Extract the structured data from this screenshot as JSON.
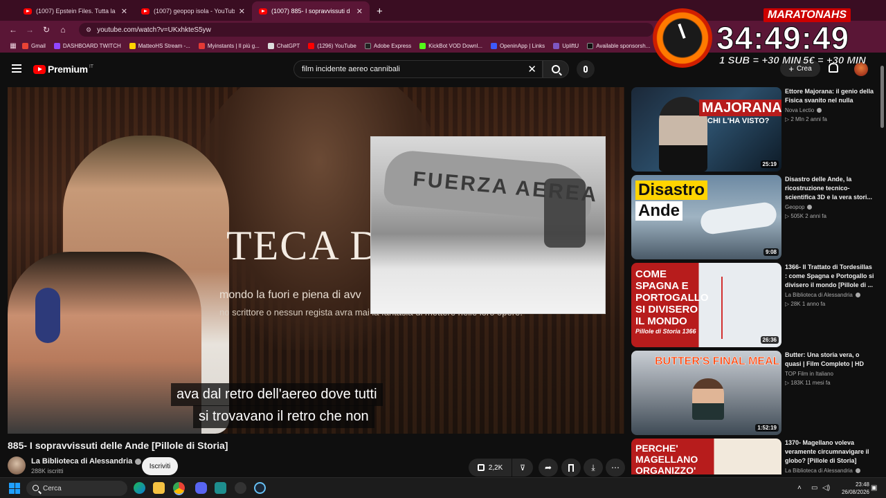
{
  "browser": {
    "tabs": [
      {
        "title": "(1007) Epstein Files. Tutta la sto",
        "active": false
      },
      {
        "title": "(1007) geopop isola - YouTube",
        "active": false
      },
      {
        "title": "(1007) 885- I sopravvissuti d",
        "active": true
      }
    ],
    "new_tab": "+",
    "close": "✕",
    "url": "youtube.com/watch?v=UKxhkteS5yw",
    "bookmarks": [
      {
        "label": "Gmail",
        "color": "#ea4335"
      },
      {
        "label": "DASHBOARD TWITCH",
        "color": "#9146ff"
      },
      {
        "label": "MatteoHS Stream -...",
        "color": "#ffd400"
      },
      {
        "label": "Myinstants | Il più g...",
        "color": "#e53935"
      },
      {
        "label": "ChatGPT",
        "color": "#dddddd"
      },
      {
        "label": "(1296) YouTube",
        "color": "#ff0000"
      },
      {
        "label": "Adobe Express",
        "color": "#222222"
      },
      {
        "label": "KickBot VOD Downl...",
        "color": "#53fc18"
      },
      {
        "label": "OpeninApp | Links",
        "color": "#3d5afe"
      },
      {
        "label": "UpliftU",
        "color": "#7e57c2"
      },
      {
        "label": "Available sponsorsh...",
        "color": "#111111"
      }
    ]
  },
  "youtube": {
    "logo_text": "Premium",
    "logo_country": "IT",
    "search_value": "film incidente aereo cannibali",
    "create_label": "Crea"
  },
  "video": {
    "overlay_title": "TECA DI A",
    "overlay_sub1": "mondo la fuori e piena di avv",
    "overlay_sub2": "no scrittore o nessun regista avra mai la fantasia di mettere nelle loro opere.",
    "inset_text": "FUERZA AEREA",
    "caption_line1": "ava dal retro dell'aereo dove tutti",
    "caption_line2": "si trovavano il retro che non",
    "title": "885- I sopravvissuti delle Ande [Pillole di Storia]",
    "channel": "La Biblioteca di Alessandria",
    "subscribers": "288K iscritti",
    "subscribe_label": "Iscriviti",
    "likes": "2,2K"
  },
  "recommendations": [
    {
      "thumb_text": "MAJORANA",
      "thumb_sub": "CHI L'HA VISTO?",
      "duration": "25:19",
      "title": "Ettore Majorana: il genio della Fisica svanito nel nulla",
      "channel": "Nova Lectio",
      "meta": "▷ 2 Mln  2 anni fa"
    },
    {
      "thumb_text": "Disastro",
      "thumb_sub": "Ande",
      "duration": "9:08",
      "title": "Disastro delle Ande, la ricostruzione tecnico-scientifica 3D e la vera stori...",
      "channel": "Geopop",
      "meta": "▷ 505K  2 anni fa"
    },
    {
      "thumb_text": "COME SPAGNA E PORTOGALLO SI DIVISERO IL MONDO",
      "thumb_sub": "Pillole di Storia 1366",
      "duration": "26:36",
      "title": "1366- Il Trattato di Tordesillas : come Spagna e Portogallo si divisero il mondo [Pillole di ...",
      "channel": "La Biblioteca di Alessandria",
      "meta": "▷ 28K  1 anno fa"
    },
    {
      "thumb_text": "BUTTER'S FINAL MEAL",
      "thumb_sub": "",
      "duration": "1:52:19",
      "title": "Butter: Una storia vera, o quasi | Film Completo | HD",
      "channel": "TOP Film in Italiano",
      "meta": "▷ 183K  11 mesi fa"
    },
    {
      "thumb_text": "PERCHE' MAGELLANO ORGANIZZO'",
      "thumb_sub": "",
      "duration": "",
      "title": "1370- Magellano voleva veramente circumnavigare il globo? [Pillole di Storia]",
      "channel": "La Biblioteca di Alessandria",
      "meta": ""
    }
  ],
  "stream_overlay": {
    "label": "MARATONAHS",
    "timer": "34:49:49",
    "rule1": "1 SUB = +30 MIN",
    "rule2": "5€ = +30 MIN"
  },
  "taskbar": {
    "search_placeholder": "Cerca",
    "time": "23:48",
    "date": "26/08/2026"
  }
}
